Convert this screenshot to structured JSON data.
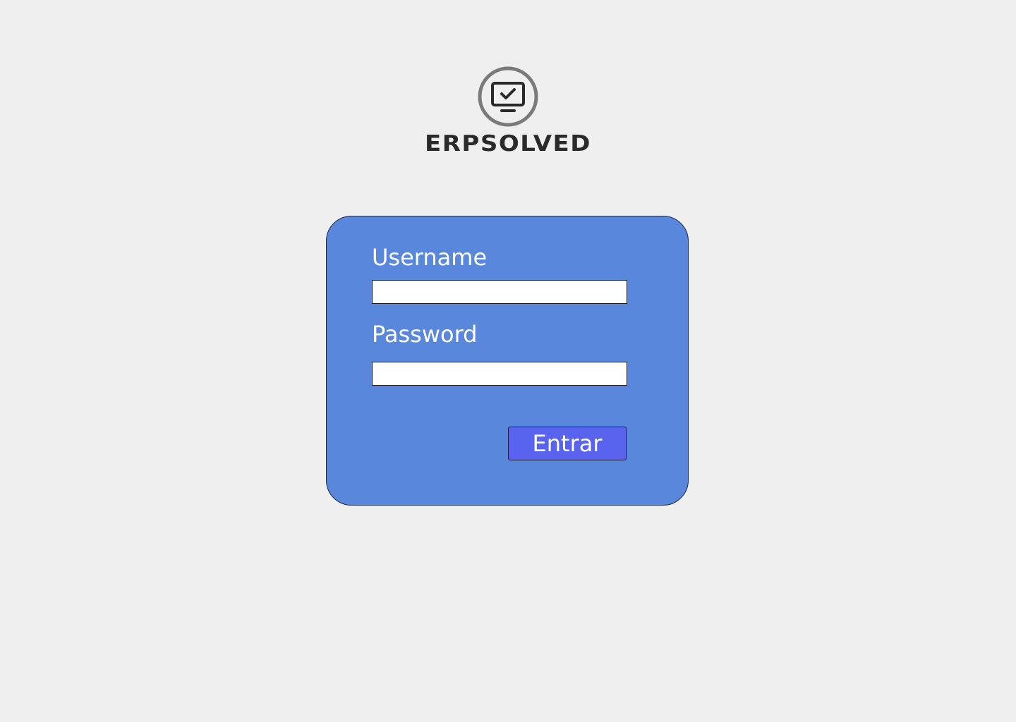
{
  "brand": {
    "name": "ERPSOLVED",
    "logo_icon": "monitor-check-icon",
    "colors": {
      "ring": "#7a7a7a",
      "monitor": "#2a2a2a",
      "text": "#2a2a2a"
    }
  },
  "login_form": {
    "background_color": "#5987db",
    "username": {
      "label": "Username",
      "value": "",
      "placeholder": ""
    },
    "password": {
      "label": "Password",
      "value": "",
      "placeholder": ""
    },
    "submit_label": "Entrar",
    "submit_color": "#5a63ed"
  }
}
